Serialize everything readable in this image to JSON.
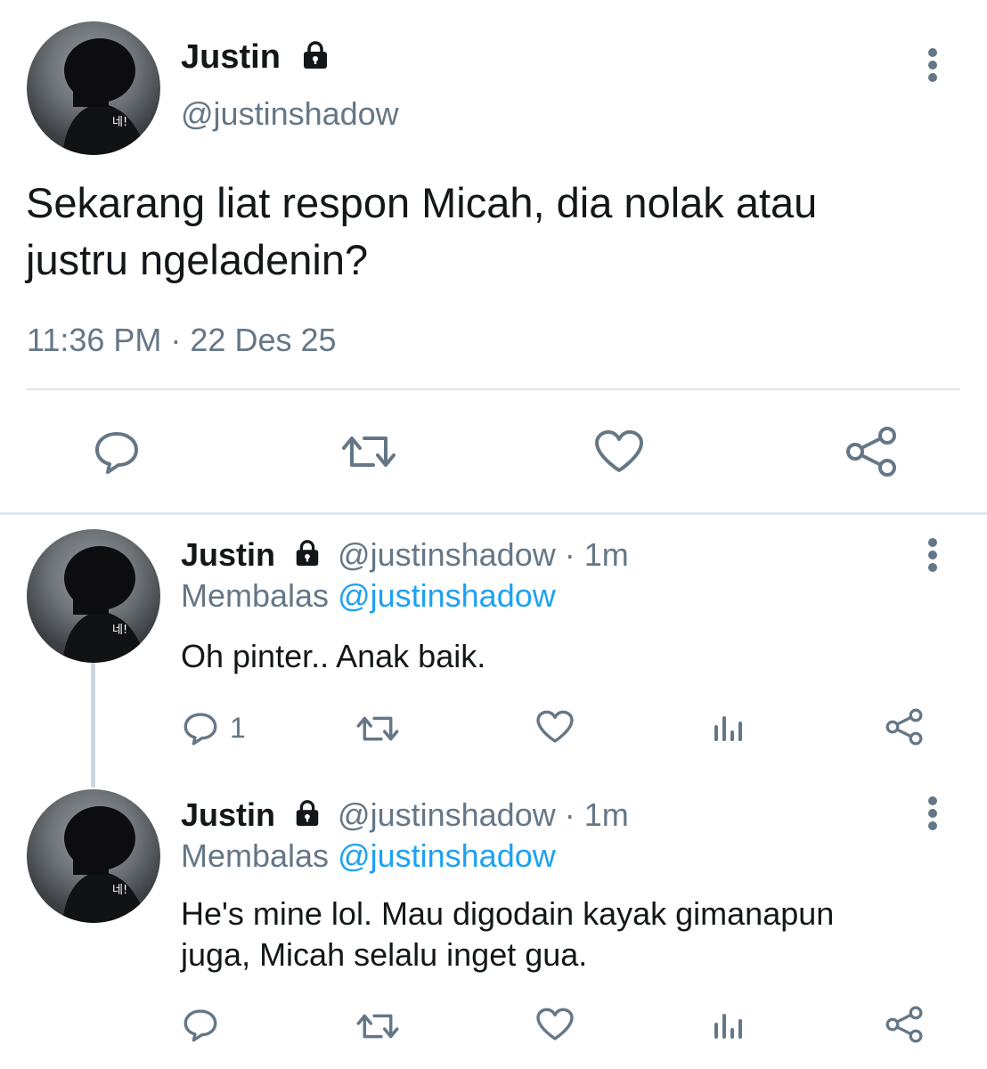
{
  "main_tweet": {
    "name": "Justin",
    "handle": "@justinshadow",
    "text_line1": "Sekarang liat respon Micah, dia nolak atau",
    "text_line2": "justru ngeladenin?",
    "timestamp": "11:36 PM · 22 Des 25",
    "avatar_badge": "네!"
  },
  "replies": [
    {
      "name": "Justin",
      "handle": "@justinshadow · 1m",
      "replying_prefix": "Membalas",
      "replying_to": "@justinshadow",
      "text_line1": "Oh pinter.. Anak baik.",
      "text_line2": "",
      "reply_count": "1",
      "avatar_badge": "네!"
    },
    {
      "name": "Justin",
      "handle": "@justinshadow · 1m",
      "replying_prefix": "Membalas",
      "replying_to": "@justinshadow",
      "text_line1": "He's mine lol. Mau digodain kayak gimanapun",
      "text_line2": "juga, Micah selalu inget gua.",
      "reply_count": "",
      "avatar_badge": "네!"
    }
  ],
  "icons": {
    "reply": "reply-icon",
    "retweet": "retweet-icon",
    "like": "heart-icon",
    "analytics": "analytics-icon",
    "share": "share-icon",
    "more": "more-icon",
    "lock": "lock-icon"
  },
  "colors": {
    "text": "#14171a",
    "secondary": "#657786",
    "link": "#1da1f2",
    "divider": "#e1e8ed"
  }
}
